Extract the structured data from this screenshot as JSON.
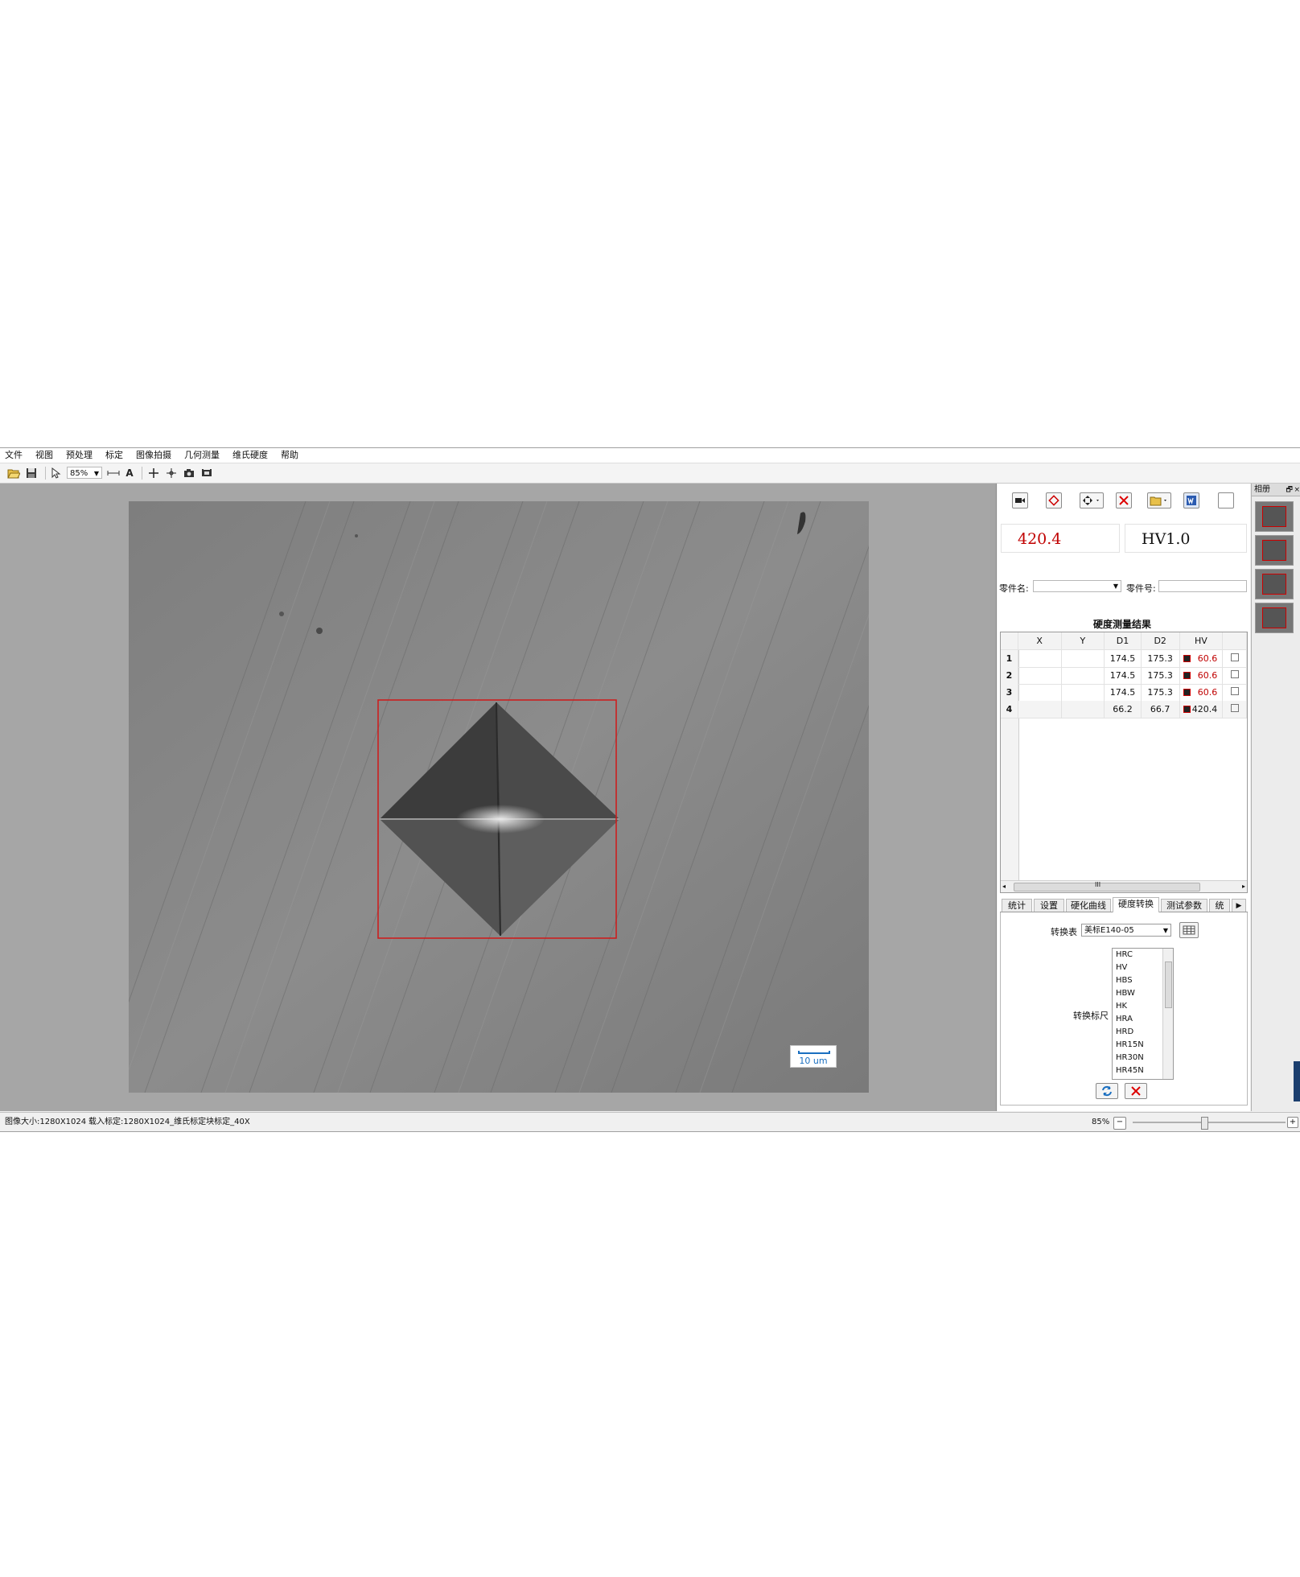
{
  "menu": [
    "文件",
    "视图",
    "预处理",
    "标定",
    "图像拍摄",
    "几何测量",
    "维氏硬度",
    "帮助"
  ],
  "toolbar": {
    "zoom_value": "85%",
    "text_tool_label": "A",
    "icons": [
      "open-folder-icon",
      "save-icon",
      "pointer-icon",
      "measure-line-icon",
      "text-tool-icon",
      "crosshair-icon",
      "move-crosshair-icon",
      "camera-icon",
      "film-icon"
    ]
  },
  "viewer": {
    "scale_bar_label": "10 um"
  },
  "panel": {
    "hardness_value": "420.4",
    "hardness_scale": "HV1.0",
    "part_name_label": "零件名:",
    "part_number_label": "零件号:",
    "part_name_value": "",
    "part_number_value": "",
    "results_title": "硬度测量结果",
    "columns": [
      "",
      "X",
      "Y",
      "D1",
      "D2",
      "HV"
    ],
    "rows": [
      {
        "n": "1",
        "x": "",
        "y": "",
        "d1": "174.5",
        "d2": "175.3",
        "hv": "60.6",
        "hv_color": "#c00000"
      },
      {
        "n": "2",
        "x": "",
        "y": "",
        "d1": "174.5",
        "d2": "175.3",
        "hv": "60.6",
        "hv_color": "#c00000"
      },
      {
        "n": "3",
        "x": "",
        "y": "",
        "d1": "174.5",
        "d2": "175.3",
        "hv": "60.6",
        "hv_color": "#c00000"
      },
      {
        "n": "4",
        "x": "",
        "y": "",
        "d1": "66.2",
        "d2": "66.7",
        "hv": "420.4",
        "hv_color": "#111111"
      }
    ],
    "scroll_mark": "III",
    "tabs": [
      "统计",
      "设置",
      "硬化曲线",
      "硬度转换",
      "测试参数",
      "统"
    ],
    "active_tab": "硬度转换",
    "conversion_table_label": "转换表",
    "conversion_table_value": "美标E140-05",
    "conversion_scale_label": "转换标尺",
    "scales": [
      "HRC",
      "HV",
      "HBS",
      "HBW",
      "HK",
      "HRA",
      "HRD",
      "HR15N",
      "HR30N",
      "HR45N"
    ]
  },
  "album": {
    "title": "相册",
    "thumbnail_count": 4
  },
  "status": {
    "image_size": "图像大小:1280X1024",
    "calibration": "载入标定:1280X1024_维氏标定块标定_40X",
    "zoom": "85%"
  },
  "colors": {
    "value_red": "#c00000",
    "indent_box": "#d01818",
    "scale_blue": "#1a6fc0"
  }
}
